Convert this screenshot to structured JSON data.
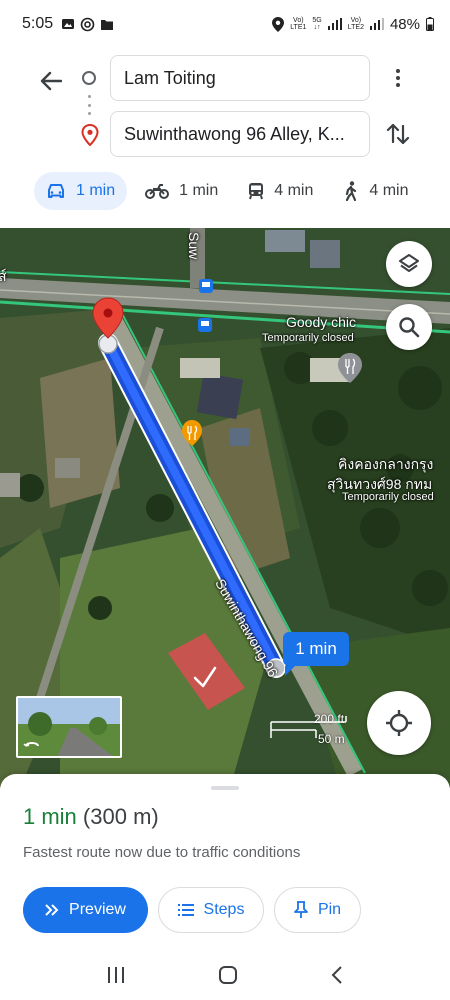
{
  "status_bar": {
    "time": "5:05",
    "left_icons": [
      "gallery-icon",
      "at-sign-icon",
      "folder-icon"
    ],
    "sim1_top": "Vo)",
    "sim1_bottom": "LTE1",
    "net_top": "5G",
    "net_bottom": "↓↑",
    "sim2_top": "Vo)",
    "sim2_bottom": "LTE2",
    "battery": "48%"
  },
  "directions": {
    "origin": "Lam Toiting",
    "destination": "Suwinthawong 96 Alley, K...",
    "modes": [
      {
        "name": "car",
        "label": "1 min",
        "active": true
      },
      {
        "name": "motorcycle",
        "label": "1 min",
        "active": false
      },
      {
        "name": "transit",
        "label": "4 min",
        "active": false
      },
      {
        "name": "walk",
        "label": "4 min",
        "active": false
      }
    ]
  },
  "map": {
    "road_label_top": "Suw",
    "road_label_route": "Suwinthawong 96",
    "road_label_edge": "ส์",
    "poi_1_name": "Goody chic",
    "poi_1_status": "Temporarily closed",
    "poi_2_name_line1": "คิงคองกลางกรุง",
    "poi_2_name_line2": "สุวินทวงศ์98 กทม",
    "poi_2_status": "Temporarily closed",
    "route_time": "1 min",
    "scale_ft": "200 ft",
    "scale_m": "50 m",
    "colors": {
      "route": "#1a73e8",
      "pin": "#ea4335",
      "road_edge": "#34c77b"
    }
  },
  "sheet": {
    "duration": "1 min",
    "distance": "(300 m)",
    "reason": "Fastest route now due to traffic conditions",
    "preview": "Preview",
    "steps": "Steps",
    "pin": "Pin"
  }
}
